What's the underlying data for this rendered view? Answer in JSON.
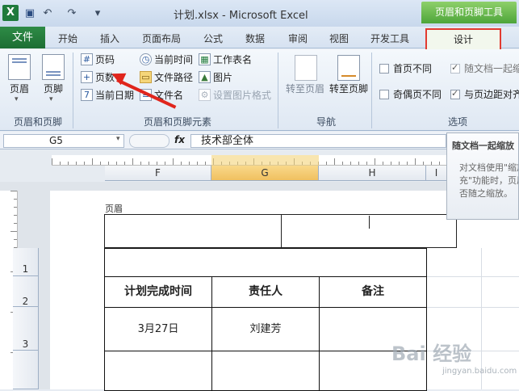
{
  "title_bar": {
    "window_title": "计划.xlsx - Microsoft Excel",
    "context_tab_title": "页眉和页脚工具",
    "app_icon": "excel-icon"
  },
  "tabs": {
    "file": "文件",
    "items": [
      "开始",
      "插入",
      "页面布局",
      "公式",
      "数据",
      "审阅",
      "视图",
      "开发工具"
    ],
    "design": "设计"
  },
  "ribbon": {
    "group1": {
      "header": "页眉",
      "footer": "页脚",
      "label": "页眉和页脚"
    },
    "group2": {
      "label": "页眉和页脚元素",
      "page_number": "页码",
      "page_count": "页数",
      "current_date": "当前日期",
      "current_time": "当前时间",
      "file_path": "文件路径",
      "file_name": "文件名",
      "sheet_name": "工作表名",
      "picture": "图片",
      "format_picture": "设置图片格式"
    },
    "group3": {
      "label": "导航",
      "go_header": "转至页眉",
      "go_footer": "转至页脚"
    },
    "group4": {
      "label": "选项",
      "first_page": "首页不同",
      "odd_even": "奇偶页不同",
      "scale_with_doc": "随文档一起缩",
      "align_margins": "与页边距对齐"
    }
  },
  "formula_bar": {
    "name_box": "G5",
    "fx": "fx",
    "value": "技术部全体"
  },
  "columns": [
    "F",
    "G",
    "H",
    "I"
  ],
  "rows": [
    "1",
    "2",
    "3"
  ],
  "sheet": {
    "header_label": "页眉",
    "table_headers": [
      "计划完成时间",
      "责任人",
      "备注"
    ],
    "row1": [
      "3月27日",
      "刘建芳",
      ""
    ]
  },
  "tooltip": {
    "title": "随文档一起缩放",
    "body": "对文档使用\"缩放以填充\"功能时，页眉和页脚是否随之缩放。"
  },
  "watermark": {
    "text": "Bai 经验",
    "sub": "jingyan.baidu.com"
  },
  "colors": {
    "file_tab": "#1d6e33",
    "context_tab": "#4da53a",
    "highlight": "#e23a30",
    "selected_col": "#f0c060"
  }
}
